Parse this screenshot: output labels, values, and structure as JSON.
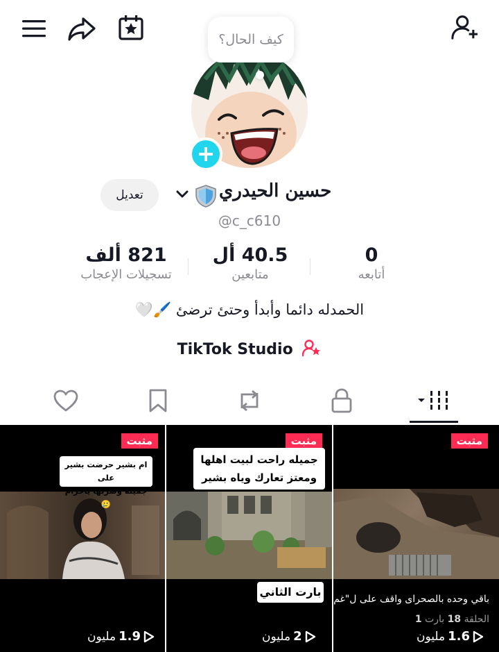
{
  "header": {
    "icons": [
      "menu-icon",
      "share-icon",
      "calendar-star-icon",
      "add-friend-icon"
    ]
  },
  "profile": {
    "bubble_text": "كيف الحال؟",
    "name": "حسين الحيدري",
    "name_emoji": "🛡️",
    "edit_label": "تعديل",
    "handle": "@c_c610",
    "bio": "الحمدله دائما وأبدأ وحتئ ترضئ 🖌️🤍",
    "studio_label": "TikTok Studio"
  },
  "stats": [
    {
      "value": "0",
      "label": "أتابعه"
    },
    {
      "value": "40.5 أل",
      "label": "متابعين"
    },
    {
      "value": "821 ألف",
      "label": "تسجيلات الإعجاب"
    }
  ],
  "tabs": [
    "videos-tab",
    "private-tab",
    "reposts-tab",
    "favorites-tab",
    "liked-tab"
  ],
  "videos": [
    {
      "pinned": "مثبت",
      "subtitle": "باقي وحده بالصحراى واقف على ل\"غم",
      "part_prefix": "الحلقة",
      "part_number": "18",
      "part_label": "بارت",
      "part_number2": "1",
      "views": "1.6",
      "views_unit": "مليون"
    },
    {
      "pinned": "مثبت",
      "caption_line1": "جميله راحت لبيت اهلها",
      "caption_line2": "ومعتز تعارك وياه بشير",
      "bottom_caption": "بارت الثاني",
      "views": "2",
      "views_unit": "مليون"
    },
    {
      "pinned": "مثبت",
      "caption_line1": "ام بشير حرضت بشير على",
      "caption_line2": "جميله وضربها ياحرام 🥲",
      "views": "1.9",
      "views_unit": "مليون"
    }
  ],
  "colors": {
    "accent_pink": "#fe2c55",
    "add_badge": "#20d5ec",
    "text_primary": "#161823",
    "text_secondary": "#8a8b91"
  }
}
